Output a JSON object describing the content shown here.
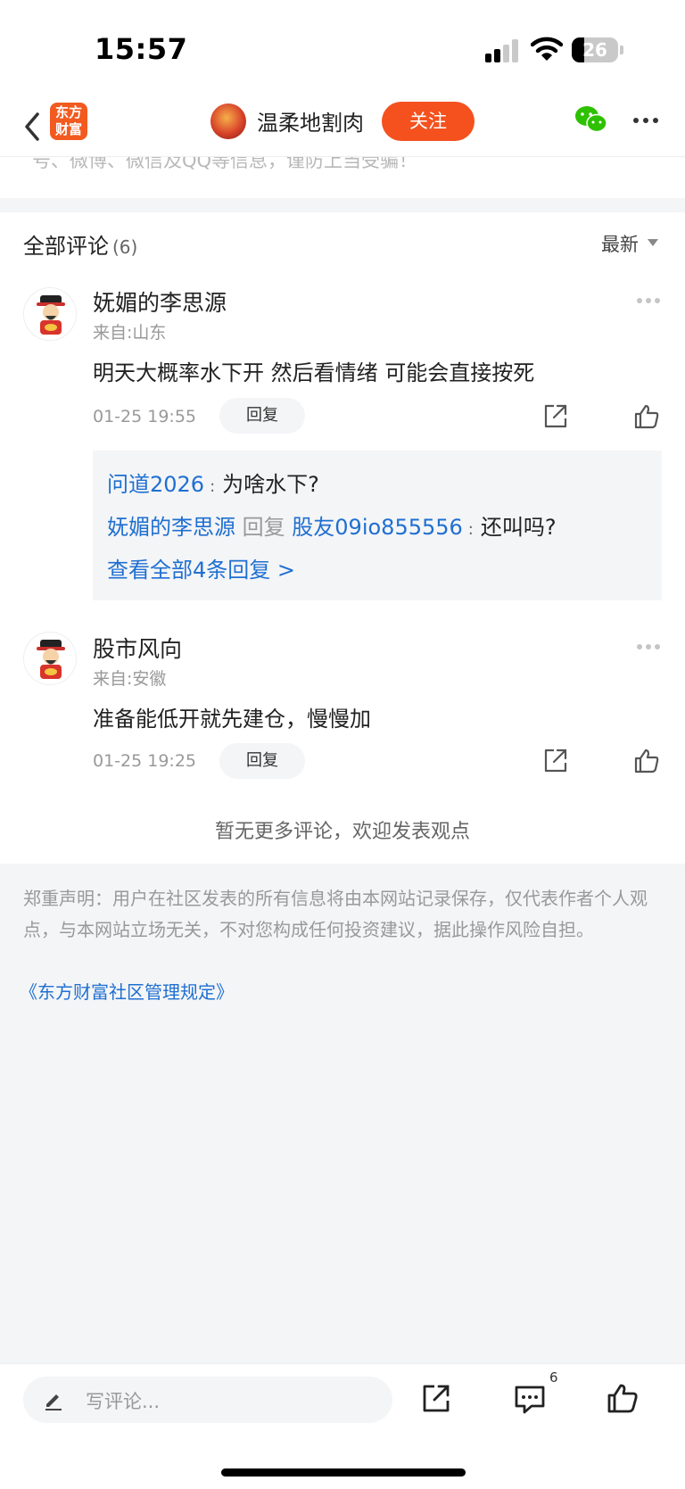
{
  "status_bar": {
    "time": "15:57",
    "battery_level": "26"
  },
  "nav": {
    "logo_text_line1": "东方",
    "logo_text_line2": "财富",
    "author_name": "温柔地割肉",
    "follow_label": "关注"
  },
  "article_cut_text": "号、微博、微信及QQ等信息，谨防上当受骗！",
  "comments_header": {
    "title": "全部评论",
    "count": "(6)",
    "sort_label": "最新"
  },
  "comments": [
    {
      "name": "妩媚的李思源",
      "location": "来自:山东",
      "text": "明天大概率水下开 然后看情绪 可能会直接按死",
      "time": "01-25 19:55",
      "reply_label": "回复",
      "replies": {
        "r1_user": "问道2026",
        "r1_text": "为啥水下?",
        "r2_user": "妩媚的李思源",
        "r2_reply_word": "回复",
        "r2_target": "股友09io855556",
        "r2_text": "还叫吗?",
        "view_all": "查看全部4条回复 >"
      }
    },
    {
      "name": "股市风向",
      "location": "来自:安徽",
      "text": "准备能低开就先建仓，慢慢加",
      "time": "01-25 19:25",
      "reply_label": "回复"
    }
  ],
  "no_more_text": "暂无更多评论，欢迎发表观点",
  "disclaimer": "郑重声明：用户在社区发表的所有信息将由本网站记录保存，仅代表作者个人观点，与本网站立场无关，不对您构成任何投资建议，据此操作风险自担。",
  "rules_link": "《东方财富社区管理规定》",
  "bottom_bar": {
    "input_placeholder": "写评论...",
    "comment_count": "6"
  },
  "colors": {
    "accent": "#f4511e",
    "link": "#1f6fd1",
    "wechat": "#2dc100"
  },
  "icons": [
    "back-icon",
    "wechat-icon",
    "more-icon",
    "share-icon",
    "like-icon",
    "pencil-icon",
    "comment-icon"
  ]
}
